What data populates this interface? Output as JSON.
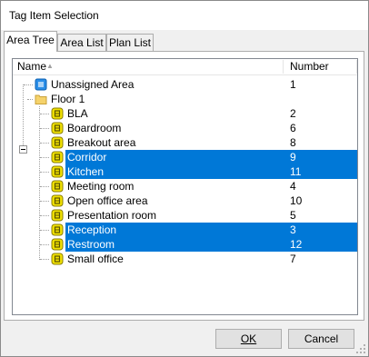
{
  "window": {
    "title": "Tag Item Selection"
  },
  "tabs": [
    {
      "label": "Area Tree",
      "active": true
    },
    {
      "label": "Area List",
      "active": false
    },
    {
      "label": "Plan List",
      "active": false
    }
  ],
  "columns": {
    "name": "Name",
    "number": "Number"
  },
  "tree": {
    "unassigned": {
      "name": "Unassigned Area",
      "number": "1"
    },
    "floor": {
      "name": "Floor 1"
    },
    "areas": [
      {
        "name": "BLA",
        "number": "2",
        "selected": false
      },
      {
        "name": "Boardroom",
        "number": "6",
        "selected": false
      },
      {
        "name": "Breakout area",
        "number": "8",
        "selected": false
      },
      {
        "name": "Corridor",
        "number": "9",
        "selected": true
      },
      {
        "name": "Kitchen",
        "number": "11",
        "selected": true
      },
      {
        "name": "Meeting room",
        "number": "4",
        "selected": false
      },
      {
        "name": "Open office area",
        "number": "10",
        "selected": false
      },
      {
        "name": "Presentation room",
        "number": "5",
        "selected": false
      },
      {
        "name": "Reception",
        "number": "3",
        "selected": true
      },
      {
        "name": "Restroom",
        "number": "12",
        "selected": true
      },
      {
        "name": "Small office",
        "number": "7",
        "selected": false
      }
    ]
  },
  "buttons": {
    "ok": "OK",
    "cancel": "Cancel"
  },
  "colors": {
    "selection": "#0078d7",
    "tag_icon": "#f2e200",
    "area_icon": "#2a8ee8",
    "folder": "#f5d26b"
  }
}
